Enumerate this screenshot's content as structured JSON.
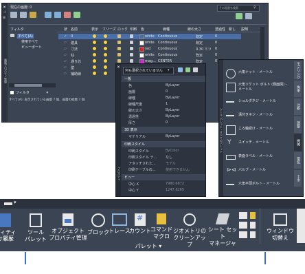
{
  "layer_manager": {
    "title_current": "現在の画層: 0",
    "search_placeholder": "その画層を検索",
    "filter_label": "フィルタ",
    "tree": [
      "すべて(A)",
      "使用すべて",
      "ビューポート"
    ],
    "invert_filter": "フィルタ",
    "status": "すべて(A): 表示されている画層 7 個、画層の総数 7 個",
    "columns": [
      "状",
      "名前",
      "表示",
      "フリーズ",
      "ロック",
      "印刷",
      "色",
      "線種",
      "線の太さ",
      "透過性",
      "新し",
      "説明"
    ],
    "rows": [
      {
        "name": "0",
        "color_name": "white",
        "color": "#ffffff",
        "linetype": "Continuous",
        "lineweight": "既定",
        "trans": "0"
      },
      {
        "name": "建具",
        "color_name": "white",
        "color": "#ffffff",
        "linetype": "Continuous",
        "lineweight": "既定",
        "trans": "0"
      },
      {
        "name": "寸法",
        "color_name": "red",
        "color": "#e02020",
        "linetype": "Continuous",
        "lineweight": "0.30 ミリ",
        "trans": "0"
      },
      {
        "name": "柱",
        "color_name": "white",
        "color": "#ffffff",
        "linetype": "Continuous",
        "lineweight": "既定",
        "trans": "0"
      },
      {
        "name": "通り芯",
        "color_name": "mag...",
        "color": "#e020e0",
        "linetype": "CENTER",
        "lineweight": "既定",
        "trans": "0"
      },
      {
        "name": "壁",
        "color_name": "",
        "color": "#ffffff",
        "linetype": "",
        "lineweight": "",
        "trans": ""
      },
      {
        "name": "補助線",
        "color_name": "",
        "color": "#ffffff",
        "linetype": "",
        "lineweight": "",
        "trans": ""
      }
    ],
    "side_label": "画層プロパティ管理"
  },
  "properties": {
    "selection": "何も選択されていません",
    "sections": [
      {
        "title": "一般",
        "rows": [
          [
            "色",
            "ByLayer"
          ],
          [
            "画層",
            "0"
          ],
          [
            "線種",
            "ByLayer"
          ],
          [
            "線種尺度",
            "1"
          ],
          [
            "線の太さ",
            "ByLayer"
          ],
          [
            "透過性",
            "ByLayer"
          ],
          [
            "厚さ",
            "0"
          ]
        ]
      },
      {
        "title": "3D 表示",
        "rows": [
          [
            "マテリアル",
            "ByLayer"
          ]
        ]
      },
      {
        "title": "印刷スタイル",
        "rows": [
          [
            "印刷スタイル",
            "ByColor"
          ],
          [
            "印刷スタイル テ...",
            "なし"
          ],
          [
            "アタッチされた...",
            "モデル"
          ],
          [
            "印刷テーブルの...",
            "使用できません"
          ]
        ]
      },
      {
        "title": "ビュー",
        "rows": [
          [
            "中心 X",
            "7980.6872"
          ],
          [
            "中心 Y",
            "1247.6265"
          ]
        ]
      }
    ],
    "side_label": "プロパティ"
  },
  "tool_palette": {
    "items": [
      "六角ナット - メートル",
      "六角ソケット ボルト (側面図) - メートル",
      "ショルダネジ - メートル",
      "溝付きネジ - メートル",
      "ころ軸受け - メートル",
      "スイッチ - メートル",
      "表面ラベル - メートル",
      "バルブ - メートル",
      "六角平頭ボルト - メートル"
    ],
    "tabs": [
      "モデリング",
      "拘束",
      "注釈",
      "建築",
      "機械",
      "電気",
      "土木"
    ],
    "side_label": "ツール パレット - すべてのパレット"
  },
  "ribbon": {
    "tab_marker": "▾",
    "buttons": [
      {
        "line1": "ディティ",
        "line2": "サイト"
      },
      {
        "line1": "ツール",
        "line2": "パレット"
      },
      {
        "line1": "オブジェクト",
        "line2": "プロパティ管理"
      },
      {
        "line1": "ブロック",
        "line2": ""
      },
      {
        "line1": "トレース",
        "line2": ""
      },
      {
        "line1": "カウント",
        "line2": ""
      },
      {
        "line1": "コマンド",
        "line2": "マクロ"
      },
      {
        "line1": "ジオメトリの",
        "line2": "クリーンアップ"
      },
      {
        "line1": "シート セット",
        "line2": "マネージャ"
      },
      {
        "line1": "ウィンドウ",
        "line2": "切替え"
      }
    ],
    "left_group": "履歴",
    "panel_label": "パレット ▾"
  }
}
